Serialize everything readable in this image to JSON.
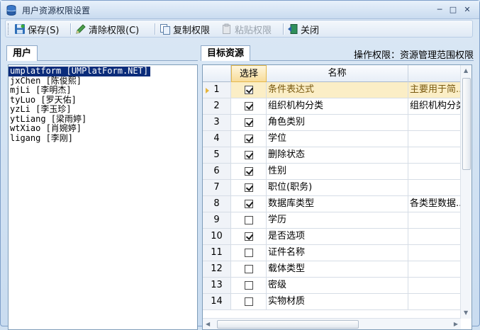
{
  "window": {
    "title": "用户资源权限设置",
    "controls": [
      "─",
      "□",
      "✕"
    ]
  },
  "toolbar": {
    "save_label": "保存(S)",
    "clear_label": "清除权限(C)",
    "copy_label": "复制权限",
    "paste_label": "粘贴权限",
    "close_label": "关闭"
  },
  "users_panel": {
    "tab_label": "用户",
    "users": [
      "umplatform [UMPlatForm.NET]",
      "jxChen [陈俊熙]",
      "mjLi [李明杰]",
      "tyLuo [罗天佑]",
      "yzLi [李玉珍]",
      "ytLiang [梁雨婷]",
      "wtXiao [肖婉婷]",
      "ligang [李刚]"
    ],
    "selected_index": 0
  },
  "resources_panel": {
    "tab_label": "目标资源",
    "operation_permission": "操作权限：资源管理范围权限",
    "columns": [
      "",
      "选择",
      "名称",
      ""
    ],
    "rows": [
      {
        "num": "1",
        "checked": true,
        "name": "条件表达式",
        "desc": "主要用于简..."
      },
      {
        "num": "2",
        "checked": true,
        "name": "组织机构分类",
        "desc": "组织机构分类"
      },
      {
        "num": "3",
        "checked": true,
        "name": "角色类别",
        "desc": ""
      },
      {
        "num": "4",
        "checked": true,
        "name": "学位",
        "desc": ""
      },
      {
        "num": "5",
        "checked": true,
        "name": "删除状态",
        "desc": ""
      },
      {
        "num": "6",
        "checked": true,
        "name": "性别",
        "desc": ""
      },
      {
        "num": "7",
        "checked": true,
        "name": "职位(职务)",
        "desc": ""
      },
      {
        "num": "8",
        "checked": true,
        "name": "数据库类型",
        "desc": "各类型数据..."
      },
      {
        "num": "9",
        "checked": false,
        "name": "学历",
        "desc": ""
      },
      {
        "num": "10",
        "checked": true,
        "name": "是否选项",
        "desc": ""
      },
      {
        "num": "11",
        "checked": false,
        "name": "证件名称",
        "desc": ""
      },
      {
        "num": "12",
        "checked": false,
        "name": "载体类型",
        "desc": ""
      },
      {
        "num": "13",
        "checked": false,
        "name": "密级",
        "desc": ""
      },
      {
        "num": "14",
        "checked": false,
        "name": "实物材质",
        "desc": ""
      }
    ],
    "current_row": 0
  },
  "colors": {
    "selected_user_bg": "#0b2c7a",
    "current_row_bg": "#fbeec6",
    "current_row_text": "#7a5a10",
    "window_bg": "#cfe0f1"
  }
}
